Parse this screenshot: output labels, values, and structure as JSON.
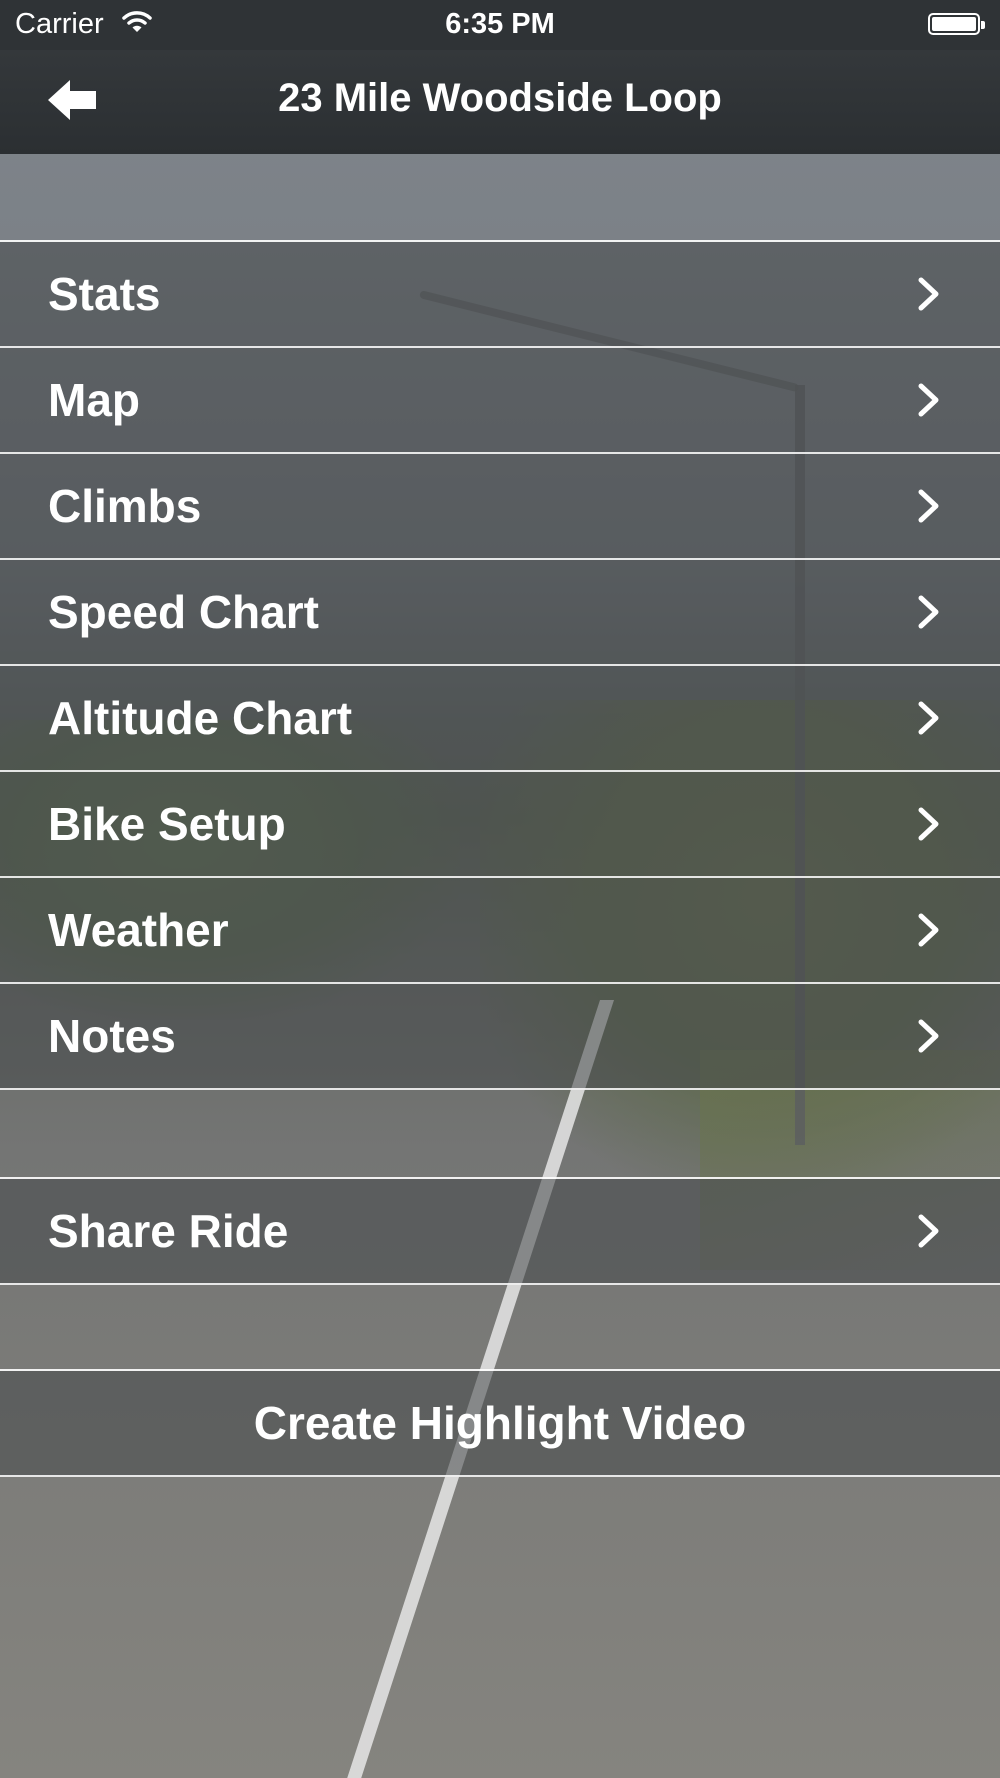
{
  "status_bar": {
    "carrier": "Carrier",
    "time": "6:35 PM",
    "icons": [
      "wifi-icon",
      "battery-icon"
    ]
  },
  "nav": {
    "title": "23 Mile Woodside Loop",
    "back_icon": "back-arrow-icon"
  },
  "menu": {
    "items": [
      {
        "label": "Stats"
      },
      {
        "label": "Map"
      },
      {
        "label": "Climbs"
      },
      {
        "label": "Speed Chart"
      },
      {
        "label": "Altitude Chart"
      },
      {
        "label": "Bike Setup"
      },
      {
        "label": "Weather"
      },
      {
        "label": "Notes"
      }
    ],
    "share": {
      "label": "Share Ride"
    },
    "create": {
      "label": "Create Highlight Video"
    }
  },
  "colors": {
    "status_bar": "#2f3336",
    "nav_bar": "#2f3336",
    "text": "#ffffff"
  }
}
